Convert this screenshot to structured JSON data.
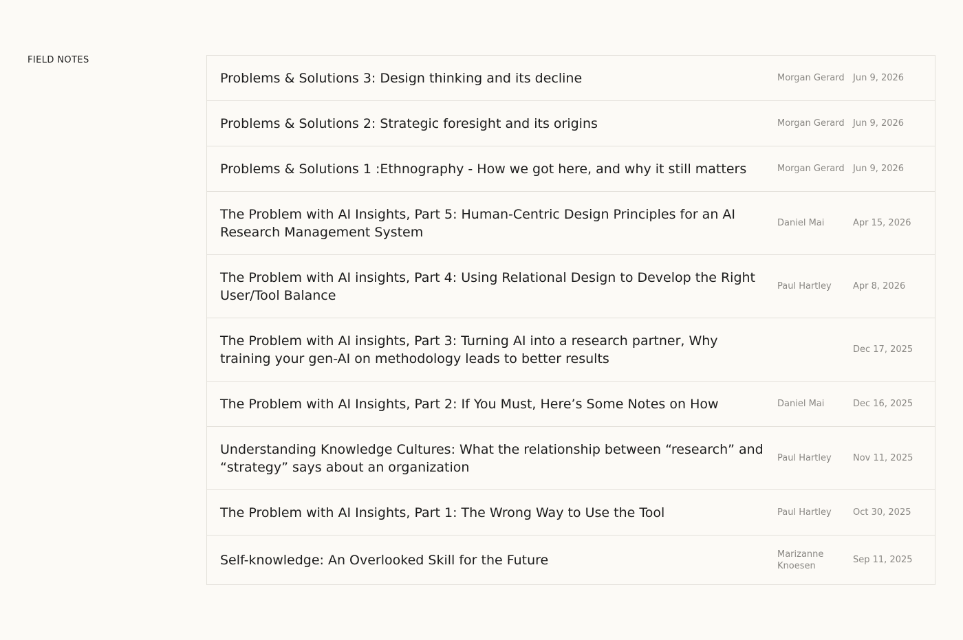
{
  "section": {
    "label": "FIELD NOTES"
  },
  "articles": [
    {
      "title": "Problems & Solutions 3: Design thinking and its decline",
      "author": "Morgan Gerard",
      "date": "Jun 9, 2026"
    },
    {
      "title": "Problems & Solutions 2: Strategic foresight and its origins",
      "author": "Morgan Gerard",
      "date": "Jun 9, 2026"
    },
    {
      "title": "Problems & Solutions 1 :Ethnography - How we got here, and why it still matters",
      "author": "Morgan Gerard",
      "date": "Jun 9, 2026"
    },
    {
      "title": "The Problem with AI Insights, Part 5:  Human-Centric Design Principles for an AI Research Management System",
      "author": "Daniel Mai",
      "date": "Apr 15, 2026"
    },
    {
      "title": "The Problem with AI insights, Part 4: Using Relational Design to Develop the Right User/Tool Balance",
      "author": "Paul Hartley",
      "date": "Apr 8, 2026"
    },
    {
      "title": "The Problem with AI insights, Part 3: Turning AI into a research partner, Why training your gen-AI on methodology leads to better results",
      "author": "",
      "date": "Dec 17, 2025"
    },
    {
      "title": "The Problem with AI Insights, Part 2: If You Must, Here’s Some Notes on How",
      "author": "Daniel Mai",
      "date": "Dec 16, 2025"
    },
    {
      "title": "Understanding Knowledge Cultures: What the relationship between “research” and “strategy” says about an organization",
      "author": "Paul Hartley",
      "date": "Nov 11, 2025"
    },
    {
      "title": "The Problem with AI Insights, Part 1: The Wrong Way to Use the Tool",
      "author": "Paul Hartley",
      "date": "Oct 30, 2025"
    },
    {
      "title": "Self-knowledge: An Overlooked Skill for the Future",
      "author": "Marizanne Knoesen",
      "date": "Sep 11, 2025"
    }
  ]
}
